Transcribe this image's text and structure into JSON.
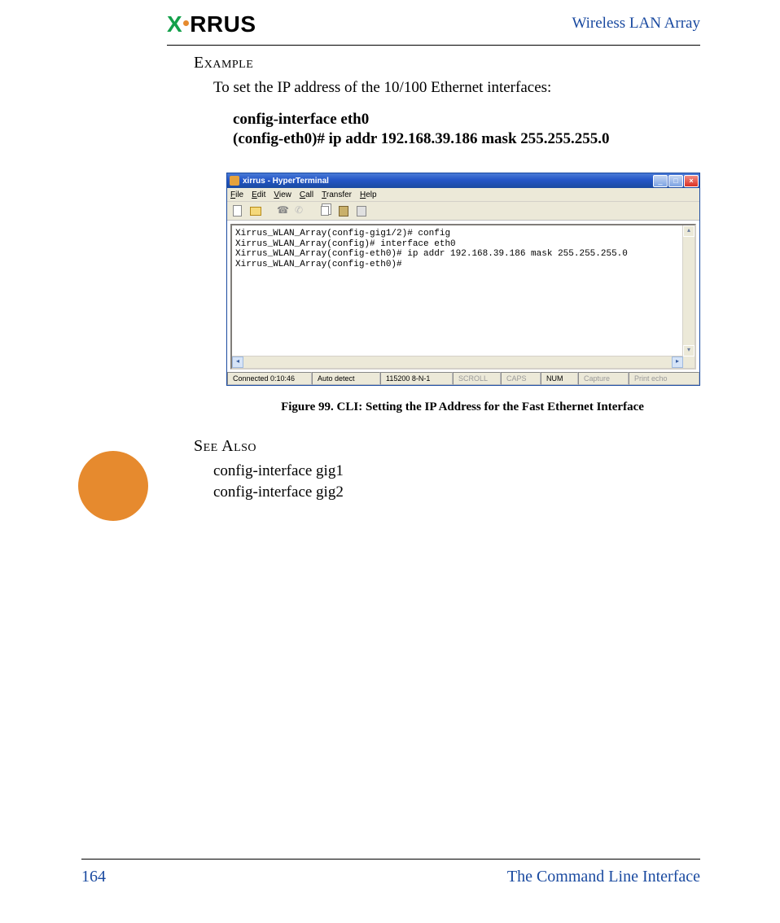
{
  "header": {
    "logo_text_part1": "X",
    "logo_text_part2": "RRUS",
    "product": "Wireless LAN Array"
  },
  "example": {
    "heading": "Example",
    "intro": "To set the IP address of the 10/100 Ethernet interfaces:",
    "cmd1": "config-interface eth0",
    "cmd2": "(config-eth0)# ip addr 192.168.39.186 mask 255.255.255.0"
  },
  "terminal": {
    "window_title": "xirrus - HyperTerminal",
    "menu": {
      "file": "File",
      "edit": "Edit",
      "view": "View",
      "call": "Call",
      "transfer": "Transfer",
      "help": "Help"
    },
    "lines": [
      "Xirrus_WLAN_Array(config-gig1/2)# config",
      "Xirrus_WLAN_Array(config)# interface eth0",
      "Xirrus_WLAN_Array(config-eth0)# ip addr 192.168.39.186 mask 255.255.255.0",
      "Xirrus_WLAN_Array(config-eth0)#"
    ],
    "status": {
      "connected": "Connected 0:10:46",
      "detect": "Auto detect",
      "baud": "115200 8-N-1",
      "scroll": "SCROLL",
      "caps": "CAPS",
      "num": "NUM",
      "capture": "Capture",
      "printecho": "Print echo"
    }
  },
  "figure_caption": "Figure 99. CLI: Setting the IP Address for the Fast Ethernet Interface",
  "see_also": {
    "heading": "See Also",
    "items": [
      "config-interface gig1",
      "config-interface gig2"
    ]
  },
  "footer": {
    "page": "164",
    "section": "The Command Line Interface"
  }
}
